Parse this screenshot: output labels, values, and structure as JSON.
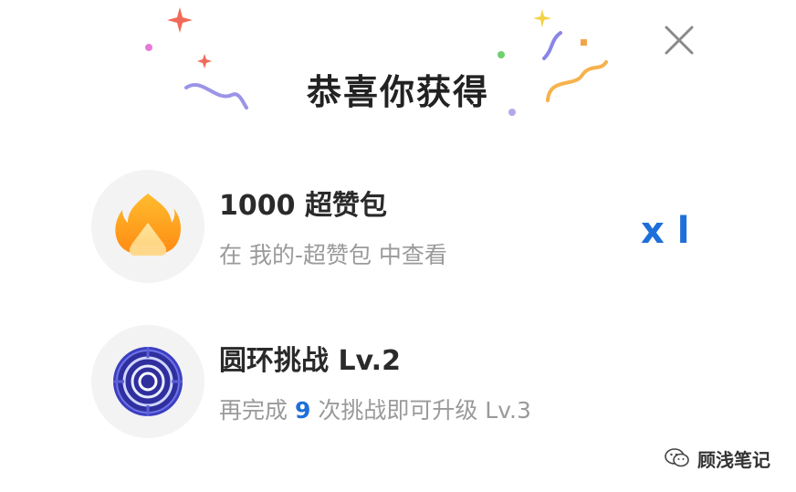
{
  "dialog": {
    "title": "恭喜你获得",
    "close_icon": "close-icon"
  },
  "rewards": [
    {
      "icon": "flame-icon",
      "name": "1000 超赞包",
      "description": "在 我的-超赞包 中查看",
      "quantity": "x l"
    },
    {
      "icon": "ring-target-icon",
      "name": "圆环挑战 Lv.2",
      "description_prefix": "再完成",
      "description_count": "9",
      "description_suffix": "次挑战即可升级 Lv.3"
    }
  ],
  "watermark": {
    "icon": "wechat-icon",
    "text": "顾浅笔记"
  },
  "colors": {
    "accent": "#1e6fd9",
    "title": "#222222",
    "muted": "#9a9a9a",
    "icon_bg": "#f3f3f3"
  }
}
